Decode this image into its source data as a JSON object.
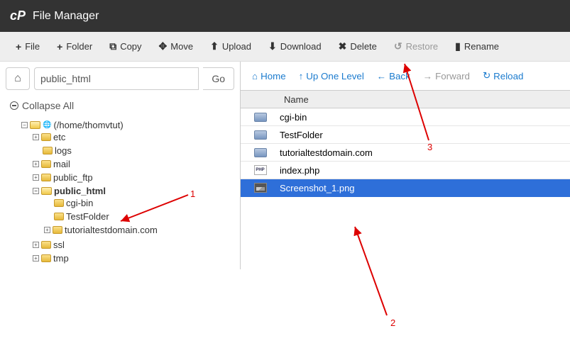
{
  "header": {
    "app": "File Manager"
  },
  "toolbar": {
    "file": "File",
    "folder": "Folder",
    "copy": "Copy",
    "move": "Move",
    "upload": "Upload",
    "download": "Download",
    "delete": "Delete",
    "restore": "Restore",
    "rename": "Rename"
  },
  "path": {
    "value": "public_html",
    "go": "Go"
  },
  "collapse_all": "Collapse All",
  "tree": {
    "root": "(/home/thomvtut)",
    "etc": "etc",
    "logs": "logs",
    "mail": "mail",
    "public_ftp": "public_ftp",
    "public_html": "public_html",
    "cgi_bin": "cgi-bin",
    "testfolder": "TestFolder",
    "tutdomain": "tutorialtestdomain.com",
    "ssl": "ssl",
    "tmp": "tmp"
  },
  "nav": {
    "home": "Home",
    "up": "Up One Level",
    "back": "Back",
    "forward": "Forward",
    "reload": "Reload"
  },
  "table": {
    "name_header": "Name"
  },
  "files": {
    "cgi_bin": "cgi-bin",
    "testfolder": "TestFolder",
    "tutdomain": "tutorialtestdomain.com",
    "index": "index.php",
    "screenshot": "Screenshot_1.png"
  },
  "annotations": {
    "n1": "1",
    "n2": "2",
    "n3": "3"
  }
}
